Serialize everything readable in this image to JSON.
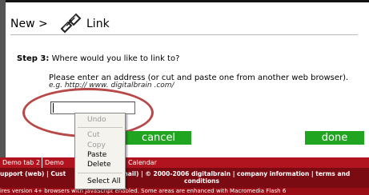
{
  "header": {
    "breadcrumb_new": "New >",
    "title": "Link",
    "link_icon": "link-chain-icon"
  },
  "form": {
    "step_label": "Step 3:",
    "step_question": "Where would you like to link to?",
    "instruction": "Please enter an address (or cut and paste one from another web browser).",
    "example": "e.g. http:// www. digitalbrain .com/",
    "address_value": ""
  },
  "buttons": {
    "cancel": "cancel",
    "done": "done"
  },
  "context_menu": {
    "items": [
      "Undo",
      "Cut",
      "Copy",
      "Paste",
      "Delete",
      "Select All"
    ],
    "disabled": [
      "Undo",
      "Cut",
      "Copy"
    ]
  },
  "tabs": {
    "tab1": "Demo tab 2",
    "tab2": "Demo",
    "tab3": "Calendar"
  },
  "footer": {
    "line1_left": "upport (web)",
    "line1_mid": "Cust",
    "line1_right": "email) | © 2000-2006 digitalbrain | company information | terms and",
    "line2": "conditions",
    "bottom": "ires version 4+ browsers with JavaScript enabled. Some areas are enhanced with Macromedia Flash 6"
  },
  "colors": {
    "button_green": "#1fa51f",
    "tabbar_red": "#b2141f",
    "footer_dark_red": "#7b0b12",
    "highlight_circle": "#b84848"
  }
}
